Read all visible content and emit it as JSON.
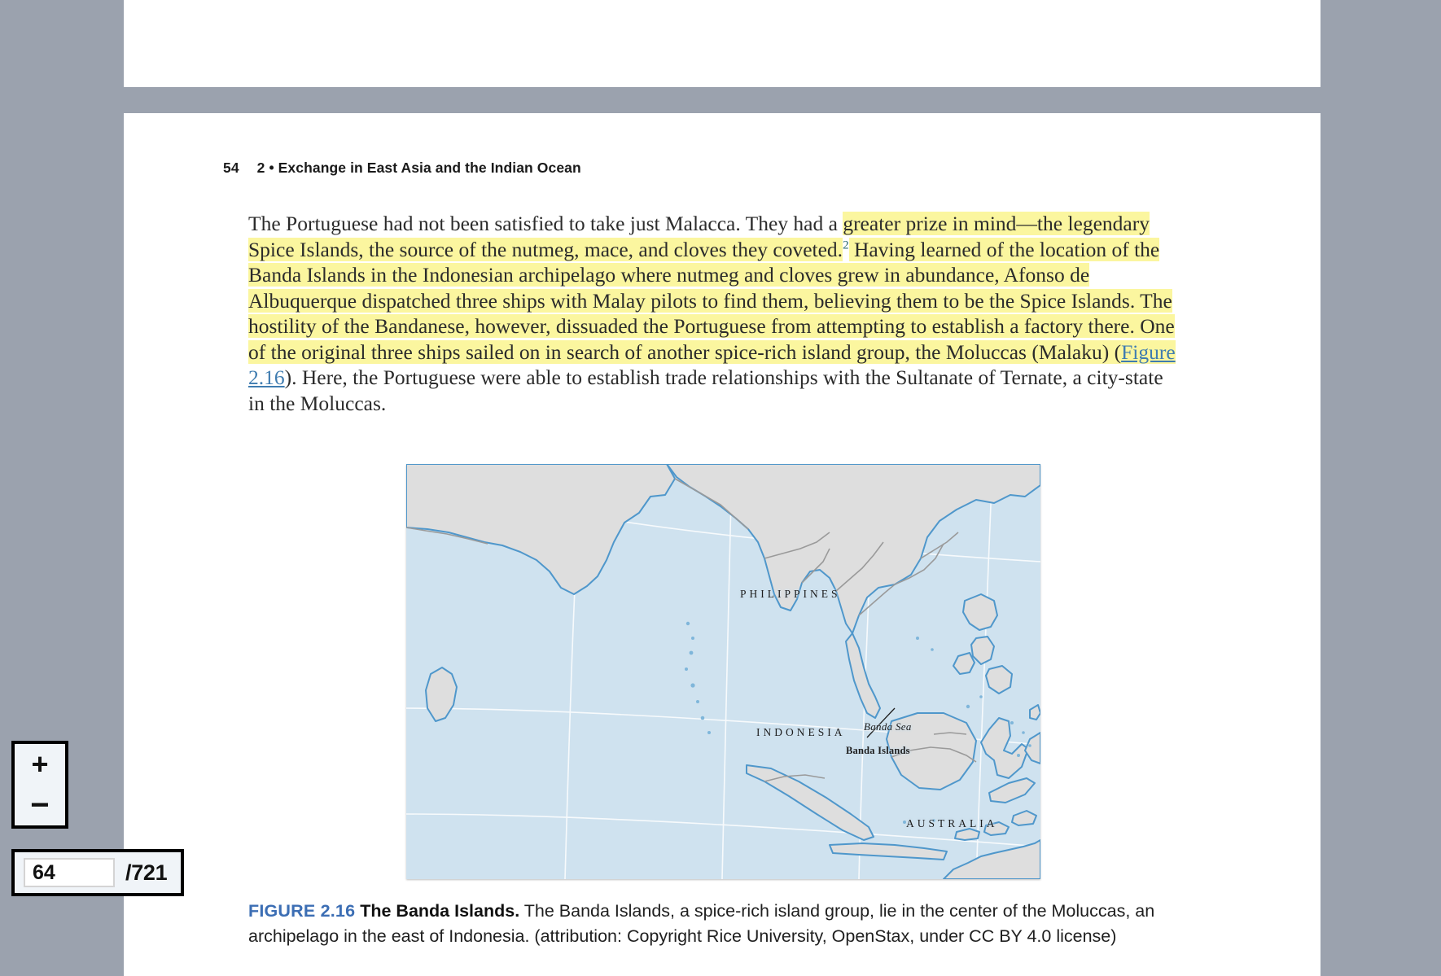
{
  "viewer": {
    "background_color": "#9ba2ae",
    "zoom": {
      "zoom_in_label": "+",
      "zoom_out_label": "−"
    },
    "pagination": {
      "current_page": "64",
      "total_label": "/721"
    }
  },
  "page": {
    "running_head": {
      "folio": "54",
      "chapter": "2 • Exchange in East Asia and the Indian Ocean"
    },
    "body": {
      "segments": [
        {
          "text": "The Portuguese had not been satisfied to take just Malacca. They had a ",
          "highlight": false
        },
        {
          "text": "greater prize in mind—the legendary Spice Islands, the source of the nutmeg, mace, and cloves they coveted.",
          "highlight": true
        },
        {
          "text": "2",
          "footnote": true
        },
        {
          "text": " Having learned of the location of the Banda Islands in the Indonesian archipelago where nutmeg and cloves grew in abundance, Afonso de Albuquerque dispatched three ships with Malay pilots to find them, believing them to be the Spice Islands. The hostility of the Bandanese, however, dissuaded the Portuguese from attempting to establish a factory there. One of the original three ships sailed on in search of another spice-rich island group, the Moluccas (Malaku) (",
          "highlight": true
        },
        {
          "text": "Figure",
          "link": true,
          "highlight": true
        },
        {
          "text": " 2.16",
          "link": true,
          "highlight": false
        },
        {
          "text": "). Here, the Portuguese were able to establish trade relationships with the Sultanate of Ternate, a city-state in the Moluccas.",
          "highlight": false
        }
      ]
    },
    "figure": {
      "caption": {
        "number": "FIGURE 2.16",
        "title": "The Banda Islands.",
        "text": " The Banda Islands, a spice-rich island group, lie in the center of the Moluccas, an archipelago in the east of Indonesia. (attribution: Copyright Rice University, OpenStax, under CC BY 4.0 license)"
      },
      "map": {
        "ocean_color": "#cfe2ef",
        "land_color": "#dedede",
        "coast_color": "#4f97cb",
        "border_color": "#9a9a9a",
        "graticule_color": "#ffffff",
        "labels": [
          {
            "name": "PHILIPPINES",
            "style": "country"
          },
          {
            "name": "INDONESIA",
            "style": "country"
          },
          {
            "name": "Banda Sea",
            "style": "sea"
          },
          {
            "name": "Banda Islands",
            "style": "islands"
          },
          {
            "name": "AUSTRALIA",
            "style": "country"
          }
        ]
      }
    }
  }
}
